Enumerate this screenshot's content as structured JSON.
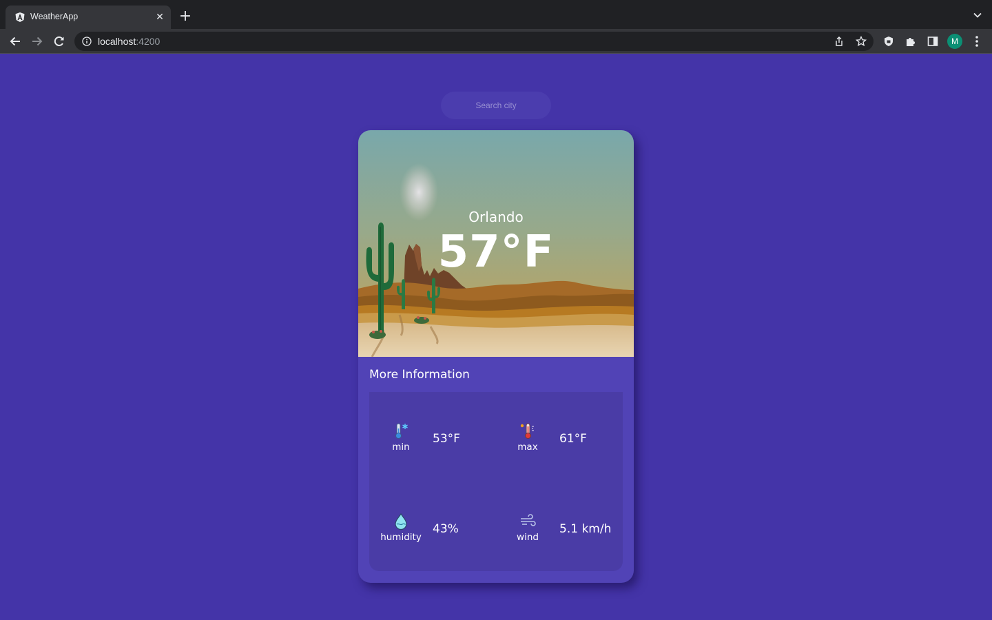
{
  "browser": {
    "tab_title": "WeatherApp",
    "url_host": "localhost",
    "url_port": ":4200",
    "profile_initial": "M"
  },
  "search": {
    "placeholder": "Search city"
  },
  "weather": {
    "city": "Orlando",
    "temperature": "57°F"
  },
  "more_info": {
    "title": "More Information",
    "min": {
      "label": "min",
      "value": "53°F",
      "icon": "thermometer-snow-icon"
    },
    "max": {
      "label": "max",
      "value": "61°F",
      "icon": "thermometer-hot-icon"
    },
    "humidity": {
      "label": "humidity",
      "value": "43%",
      "icon": "water-drop-icon"
    },
    "wind": {
      "label": "wind",
      "value": "5.1 km/h",
      "icon": "wind-icon"
    }
  },
  "colors": {
    "page_background": "#4434a8",
    "card_background": "#5143b6",
    "panel_background": "#4a3ca6",
    "browser_dark": "#202124",
    "profile_avatar": "#0b8f74"
  }
}
